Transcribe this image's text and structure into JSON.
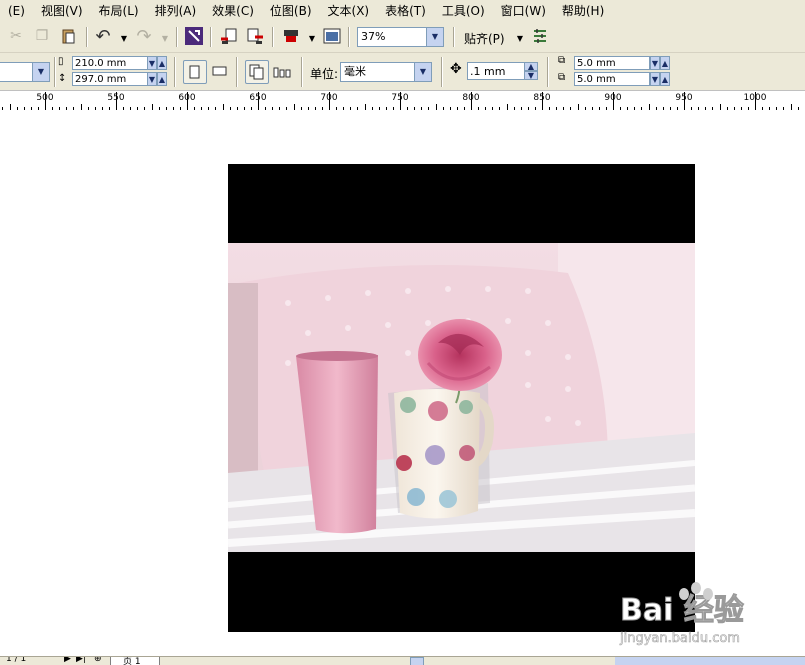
{
  "menubar": {
    "items": [
      "(E)",
      "视图(V)",
      "布局(L)",
      "排列(A)",
      "效果(C)",
      "位图(B)",
      "文本(X)",
      "表格(T)",
      "工具(O)",
      "窗口(W)",
      "帮助(H)"
    ]
  },
  "standard_toolbar": {
    "zoom_value": "37%",
    "snap_label": "贴齐(P)"
  },
  "property_bar": {
    "width_value": "210.0 mm",
    "height_value": "297.0 mm",
    "units_label": "单位:",
    "units_value": "毫米",
    "nudge_value": ".1 mm",
    "dup_x_value": "5.0 mm",
    "dup_y_value": "5.0 mm"
  },
  "ruler": {
    "labels": [
      "500",
      "550",
      "600",
      "650",
      "700",
      "750",
      "800",
      "850",
      "900",
      "950",
      "1000"
    ]
  },
  "statusbar": {
    "page_counter": "1 / 1",
    "page_tab": "页 1"
  },
  "watermark": {
    "brand": "Bai 经验",
    "url": "jingyan.baidu.com"
  },
  "colors": {
    "chrome": "#ece9d8",
    "input_border": "#7f9db9",
    "accent_blue": "#c5d3f0"
  }
}
